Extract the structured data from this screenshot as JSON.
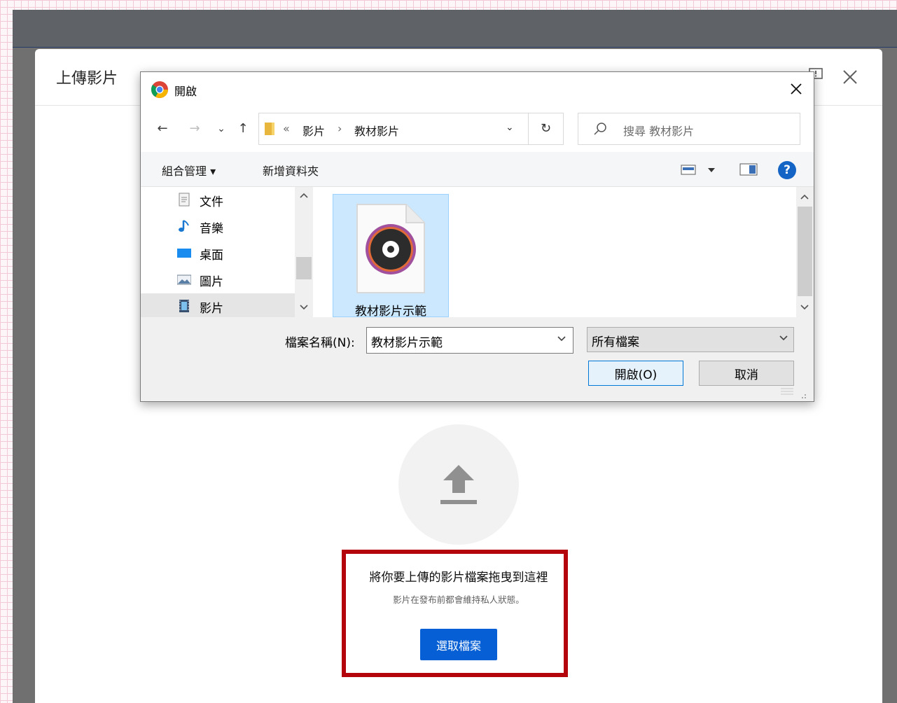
{
  "upload_dialog": {
    "title": "上傳影片",
    "drop_text": "將你要上傳的影片檔案拖曳到這裡",
    "drop_subtext": "影片在發布前都會維持私人狀態。",
    "select_button": "選取檔案"
  },
  "file_dialog": {
    "title": "開啟",
    "nav": {
      "back": "←",
      "forward": "→",
      "recent": "⌄",
      "up": "↑",
      "path_prefix": "«",
      "path": [
        "影片",
        "教材影片"
      ],
      "separator": "›",
      "dropdown": "⌄",
      "refresh": "↻"
    },
    "search_placeholder": "搜尋 教材影片",
    "toolbar": {
      "organize": "組合管理 ▾",
      "new_folder": "新增資料夾",
      "help": "?"
    },
    "tree": [
      {
        "label": "文件",
        "icon": "document-icon"
      },
      {
        "label": "音樂",
        "icon": "music-icon"
      },
      {
        "label": "桌面",
        "icon": "desktop-icon"
      },
      {
        "label": "圖片",
        "icon": "pictures-icon"
      },
      {
        "label": "影片",
        "icon": "videos-icon",
        "selected": true
      }
    ],
    "files": [
      {
        "name": "教材影片示範",
        "icon": "video-file-icon"
      }
    ],
    "filename_label": "檔案名稱(N):",
    "filename_value": "教材影片示範",
    "filetype_value": "所有檔案",
    "open_button": "開啟(O)",
    "cancel_button": "取消"
  },
  "colors": {
    "accent": "#065fd4",
    "highlight_border": "#b4050d",
    "selection": "#cce8ff"
  }
}
